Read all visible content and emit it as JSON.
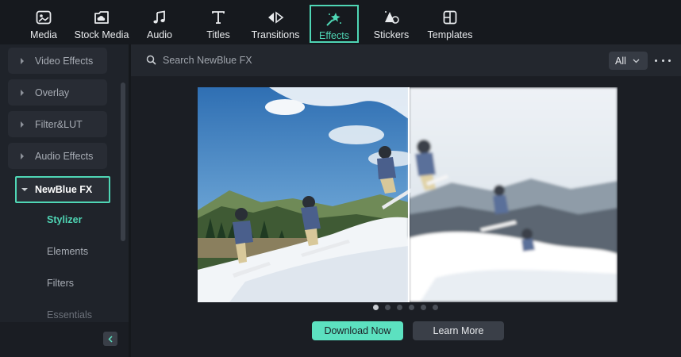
{
  "toolbar": {
    "items": [
      {
        "label": "Media",
        "icon": "media-icon"
      },
      {
        "label": "Stock Media",
        "icon": "stock-media-icon"
      },
      {
        "label": "Audio",
        "icon": "music-note-icon"
      },
      {
        "label": "Titles",
        "icon": "text-t-icon"
      },
      {
        "label": "Transitions",
        "icon": "transition-arrow-icon"
      },
      {
        "label": "Effects",
        "icon": "magic-wand-icon",
        "active": true
      },
      {
        "label": "Stickers",
        "icon": "sticker-icon"
      },
      {
        "label": "Templates",
        "icon": "templates-grid-icon"
      }
    ]
  },
  "sidebar": {
    "categories": [
      {
        "label": "Video Effects"
      },
      {
        "label": "Overlay"
      },
      {
        "label": "Filter&LUT"
      },
      {
        "label": "Audio Effects"
      },
      {
        "label": "NewBlue FX",
        "expanded": true,
        "selected": true
      }
    ],
    "subitems": [
      {
        "label": "Stylizer",
        "active": true
      },
      {
        "label": "Elements"
      },
      {
        "label": "Filters"
      },
      {
        "label": "Essentials"
      }
    ]
  },
  "search": {
    "placeholder": "Search NewBlue FX",
    "value": ""
  },
  "filter": {
    "selected": "All"
  },
  "carousel": {
    "total": 6,
    "active_index": 0
  },
  "actions": {
    "download_label": "Download Now",
    "learn_more_label": "Learn More"
  },
  "colors": {
    "accent": "#4fd6b5",
    "primary_button": "#5ce1c0",
    "background": "#1b1e24",
    "sidebar": "#1f232a",
    "toolbar": "#16191e"
  }
}
